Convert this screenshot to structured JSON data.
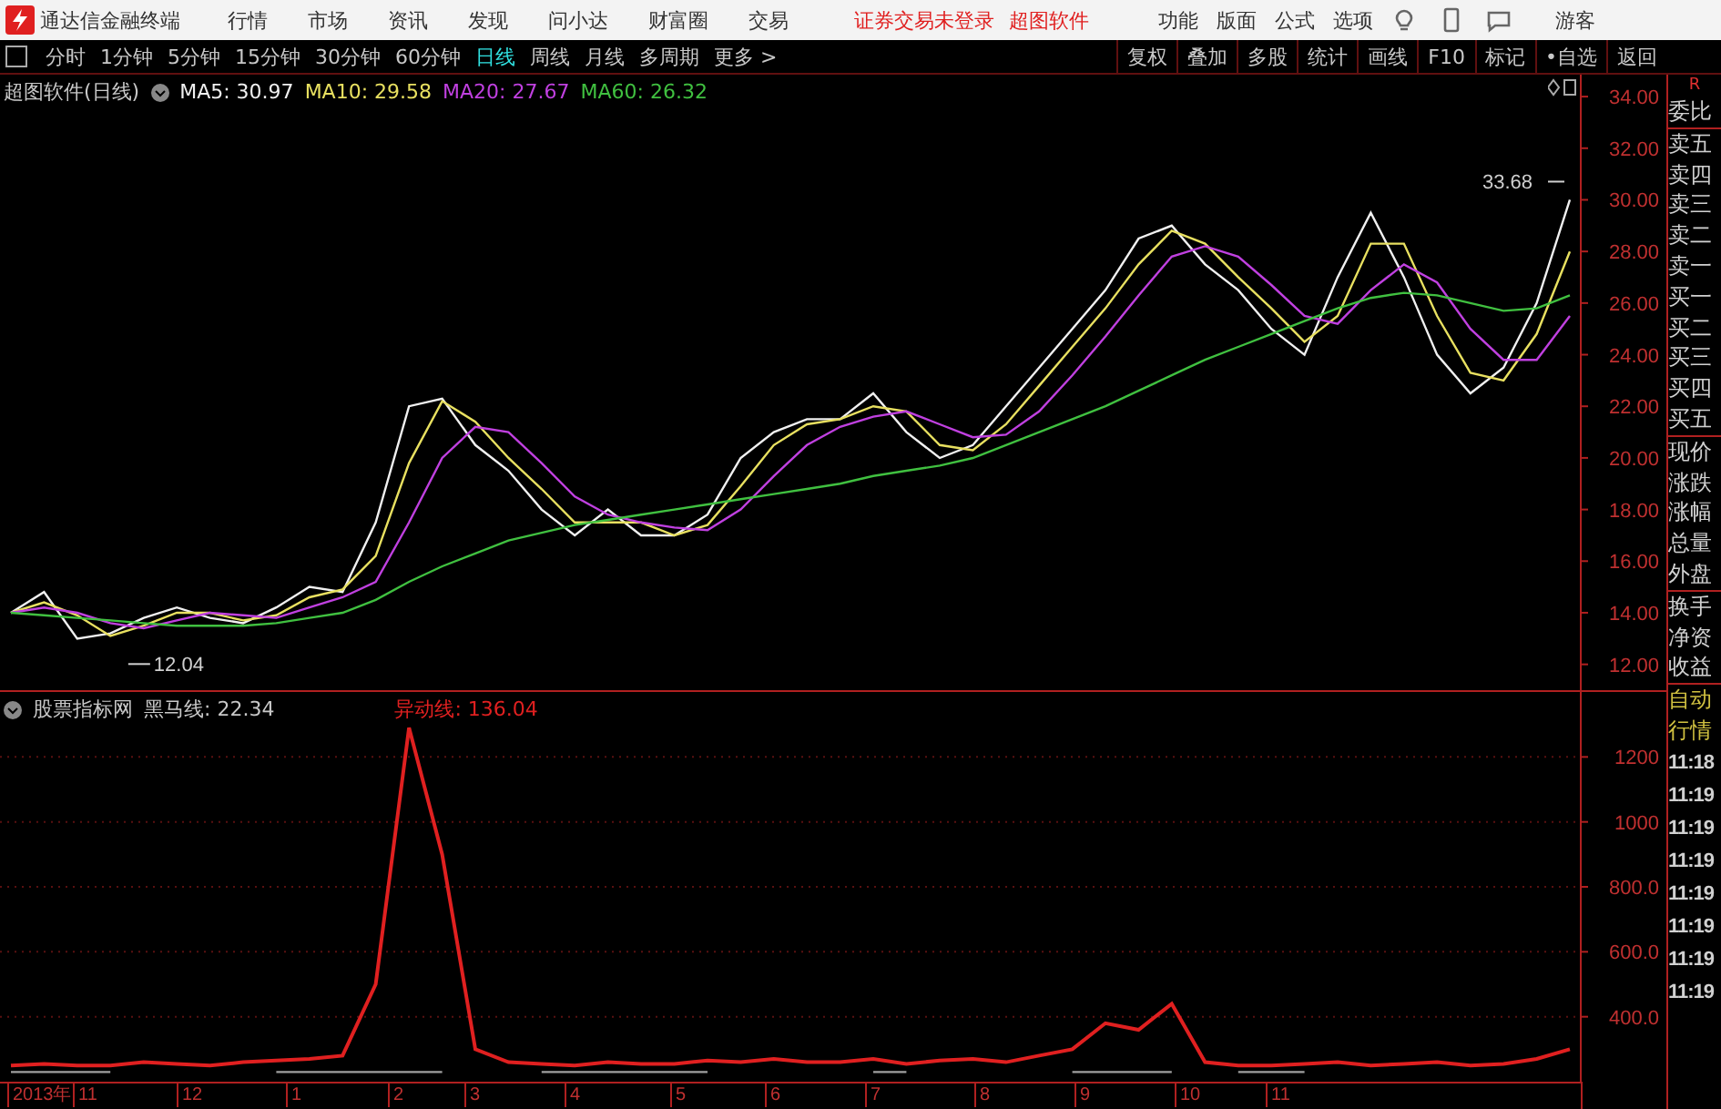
{
  "title_bar": {
    "app_name": "通达信金融终端",
    "menu": [
      "行情",
      "市场",
      "资讯",
      "发现",
      "问小达",
      "财富圈",
      "交易"
    ],
    "notices": [
      "证券交易未登录",
      "超图软件"
    ],
    "tools": [
      "功能",
      "版面",
      "公式",
      "选项"
    ],
    "user": "游客"
  },
  "toolbar": {
    "periods": [
      {
        "label": "分时",
        "selected": false
      },
      {
        "label": "1分钟",
        "selected": false
      },
      {
        "label": "5分钟",
        "selected": false
      },
      {
        "label": "15分钟",
        "selected": false
      },
      {
        "label": "30分钟",
        "selected": false
      },
      {
        "label": "60分钟",
        "selected": false
      },
      {
        "label": "日线",
        "selected": true
      },
      {
        "label": "周线",
        "selected": false
      },
      {
        "label": "月线",
        "selected": false
      },
      {
        "label": "多周期",
        "selected": false
      },
      {
        "label": "更多 >",
        "selected": false
      }
    ],
    "actions": [
      "复权",
      "叠加",
      "多股",
      "统计",
      "画线",
      "F10",
      "标记",
      "•自选",
      "返回"
    ]
  },
  "price_panel": {
    "title": "超图软件(日线)",
    "legend_values": [
      ": 30.97",
      ": 29.58",
      ": 27.67",
      ": 26.32"
    ],
    "chart_data": {
      "type": "line",
      "ylim": [
        11,
        34.85
      ],
      "yticks": [
        {
          "value": 34,
          "label": "34.00"
        },
        {
          "value": 32,
          "label": "32.00"
        },
        {
          "value": 30,
          "label": "30.00"
        },
        {
          "value": 28,
          "label": "28.00"
        },
        {
          "value": 26,
          "label": "26.00"
        },
        {
          "value": 24,
          "label": "24.00"
        },
        {
          "value": 22,
          "label": "22.00"
        },
        {
          "value": 20,
          "label": "20.00"
        },
        {
          "value": 18,
          "label": "18.00"
        },
        {
          "value": 16,
          "label": "16.00"
        },
        {
          "value": 14,
          "label": "14.00"
        },
        {
          "value": 12,
          "label": "12.00"
        }
      ],
      "series": [
        {
          "name": "MA5",
          "color": "#f0f0f0",
          "values": [
            14.0,
            14.8,
            13.0,
            13.2,
            13.8,
            14.2,
            13.8,
            13.6,
            14.2,
            15.0,
            14.8,
            17.5,
            22.0,
            22.3,
            20.5,
            19.5,
            18.0,
            17.0,
            18.0,
            17.0,
            17.0,
            17.8,
            20.0,
            21.0,
            21.5,
            21.5,
            22.5,
            21.0,
            20.0,
            20.5,
            22.0,
            23.5,
            25.0,
            26.5,
            28.5,
            29.0,
            27.5,
            26.5,
            25.0,
            24.0,
            27.0,
            29.5,
            27.0,
            24.0,
            22.5,
            23.5,
            26.0,
            30.0
          ]
        },
        {
          "name": "MA10",
          "color": "#e8e060",
          "values": [
            14.0,
            14.4,
            13.9,
            13.1,
            13.5,
            14.0,
            14.0,
            13.7,
            13.9,
            14.6,
            14.9,
            16.2,
            19.8,
            22.2,
            21.4,
            20.0,
            18.8,
            17.5,
            17.5,
            17.5,
            17.0,
            17.4,
            18.9,
            20.5,
            21.3,
            21.5,
            22.0,
            21.8,
            20.5,
            20.3,
            21.3,
            22.8,
            24.3,
            25.8,
            27.5,
            28.8,
            28.3,
            27.0,
            25.8,
            24.5,
            25.5,
            28.3,
            28.3,
            25.5,
            23.3,
            23.0,
            24.8,
            28.0
          ]
        },
        {
          "name": "MA20",
          "color": "#c040e0",
          "values": [
            14.0,
            14.2,
            14.0,
            13.6,
            13.4,
            13.7,
            14.0,
            13.9,
            13.8,
            14.2,
            14.6,
            15.2,
            17.5,
            20.0,
            21.2,
            21.0,
            19.8,
            18.5,
            17.8,
            17.5,
            17.3,
            17.2,
            18.0,
            19.3,
            20.5,
            21.2,
            21.6,
            21.8,
            21.3,
            20.8,
            20.9,
            21.8,
            23.2,
            24.7,
            26.3,
            27.8,
            28.2,
            27.8,
            26.7,
            25.5,
            25.2,
            26.5,
            27.5,
            26.8,
            25.0,
            23.8,
            23.8,
            25.5
          ]
        },
        {
          "name": "MA60",
          "color": "#40c040",
          "values": [
            14.0,
            13.9,
            13.8,
            13.7,
            13.6,
            13.5,
            13.5,
            13.5,
            13.6,
            13.8,
            14.0,
            14.5,
            15.2,
            15.8,
            16.3,
            16.8,
            17.1,
            17.4,
            17.6,
            17.8,
            18.0,
            18.2,
            18.4,
            18.6,
            18.8,
            19.0,
            19.3,
            19.5,
            19.7,
            20.0,
            20.5,
            21.0,
            21.5,
            22.0,
            22.6,
            23.2,
            23.8,
            24.3,
            24.8,
            25.3,
            25.8,
            26.2,
            26.4,
            26.3,
            26.0,
            25.7,
            25.8,
            26.3
          ]
        }
      ],
      "annotations": [
        {
          "text": "33.68"
        },
        {
          "text": "12.04"
        }
      ]
    }
  },
  "indicator_panel": {
    "title": "股票指标网",
    "legend_values": [
      ": 22.34",
      ": 136.04"
    ],
    "chart_data": {
      "type": "line",
      "ylim": [
        200,
        1400
      ],
      "grid": true,
      "yticks": [
        {
          "value": 1200,
          "label": "1200"
        },
        {
          "value": 1000,
          "label": "1000"
        },
        {
          "value": 800,
          "label": "800.0"
        },
        {
          "value": 600,
          "label": "600.0"
        },
        {
          "value": 400,
          "label": "400.0"
        }
      ],
      "series": [
        {
          "name": "异动线",
          "color": "#e02020",
          "values": [
            250,
            255,
            250,
            250,
            260,
            255,
            250,
            260,
            265,
            270,
            280,
            500,
            1290,
            900,
            300,
            260,
            255,
            250,
            260,
            255,
            255,
            265,
            260,
            270,
            260,
            260,
            270,
            255,
            265,
            270,
            260,
            280,
            300,
            380,
            360,
            440,
            260,
            250,
            250,
            255,
            260,
            250,
            255,
            260,
            250,
            255,
            270,
            300
          ]
        },
        {
          "name": "黑马线",
          "color": "#a0a0a0",
          "values": [
            230,
            230,
            230,
            230,
            null,
            null,
            null,
            null,
            230,
            230,
            230,
            230,
            230,
            230,
            null,
            null,
            230,
            230,
            230,
            230,
            230,
            230,
            null,
            null,
            null,
            null,
            230,
            230,
            null,
            null,
            null,
            null,
            230,
            230,
            230,
            230,
            null,
            230,
            230,
            230,
            null,
            null,
            null,
            null,
            null,
            null,
            null,
            null
          ]
        }
      ]
    },
    "x_labels": [
      "2013年",
      "11",
      "12",
      "1",
      "2",
      "3",
      "4",
      "5",
      "6",
      "7",
      "8",
      "9",
      "10",
      "11"
    ]
  },
  "quote_panel": {
    "header": "R",
    "groups": [
      [
        "委比"
      ],
      [
        "卖五",
        "卖四",
        "卖三",
        "卖二",
        "卖一",
        "买一",
        "买二",
        "买三",
        "买四",
        "买五"
      ],
      [
        "现价",
        "涨跌",
        "涨幅",
        "总量",
        "外盘"
      ],
      [
        "换手",
        "净资",
        "收益"
      ]
    ],
    "auto_label": [
      "自动",
      "行情"
    ],
    "times": [
      "11:18",
      "11:19",
      "11:19",
      "11:19",
      "11:19",
      "11:19",
      "11:19",
      "11:19"
    ]
  }
}
